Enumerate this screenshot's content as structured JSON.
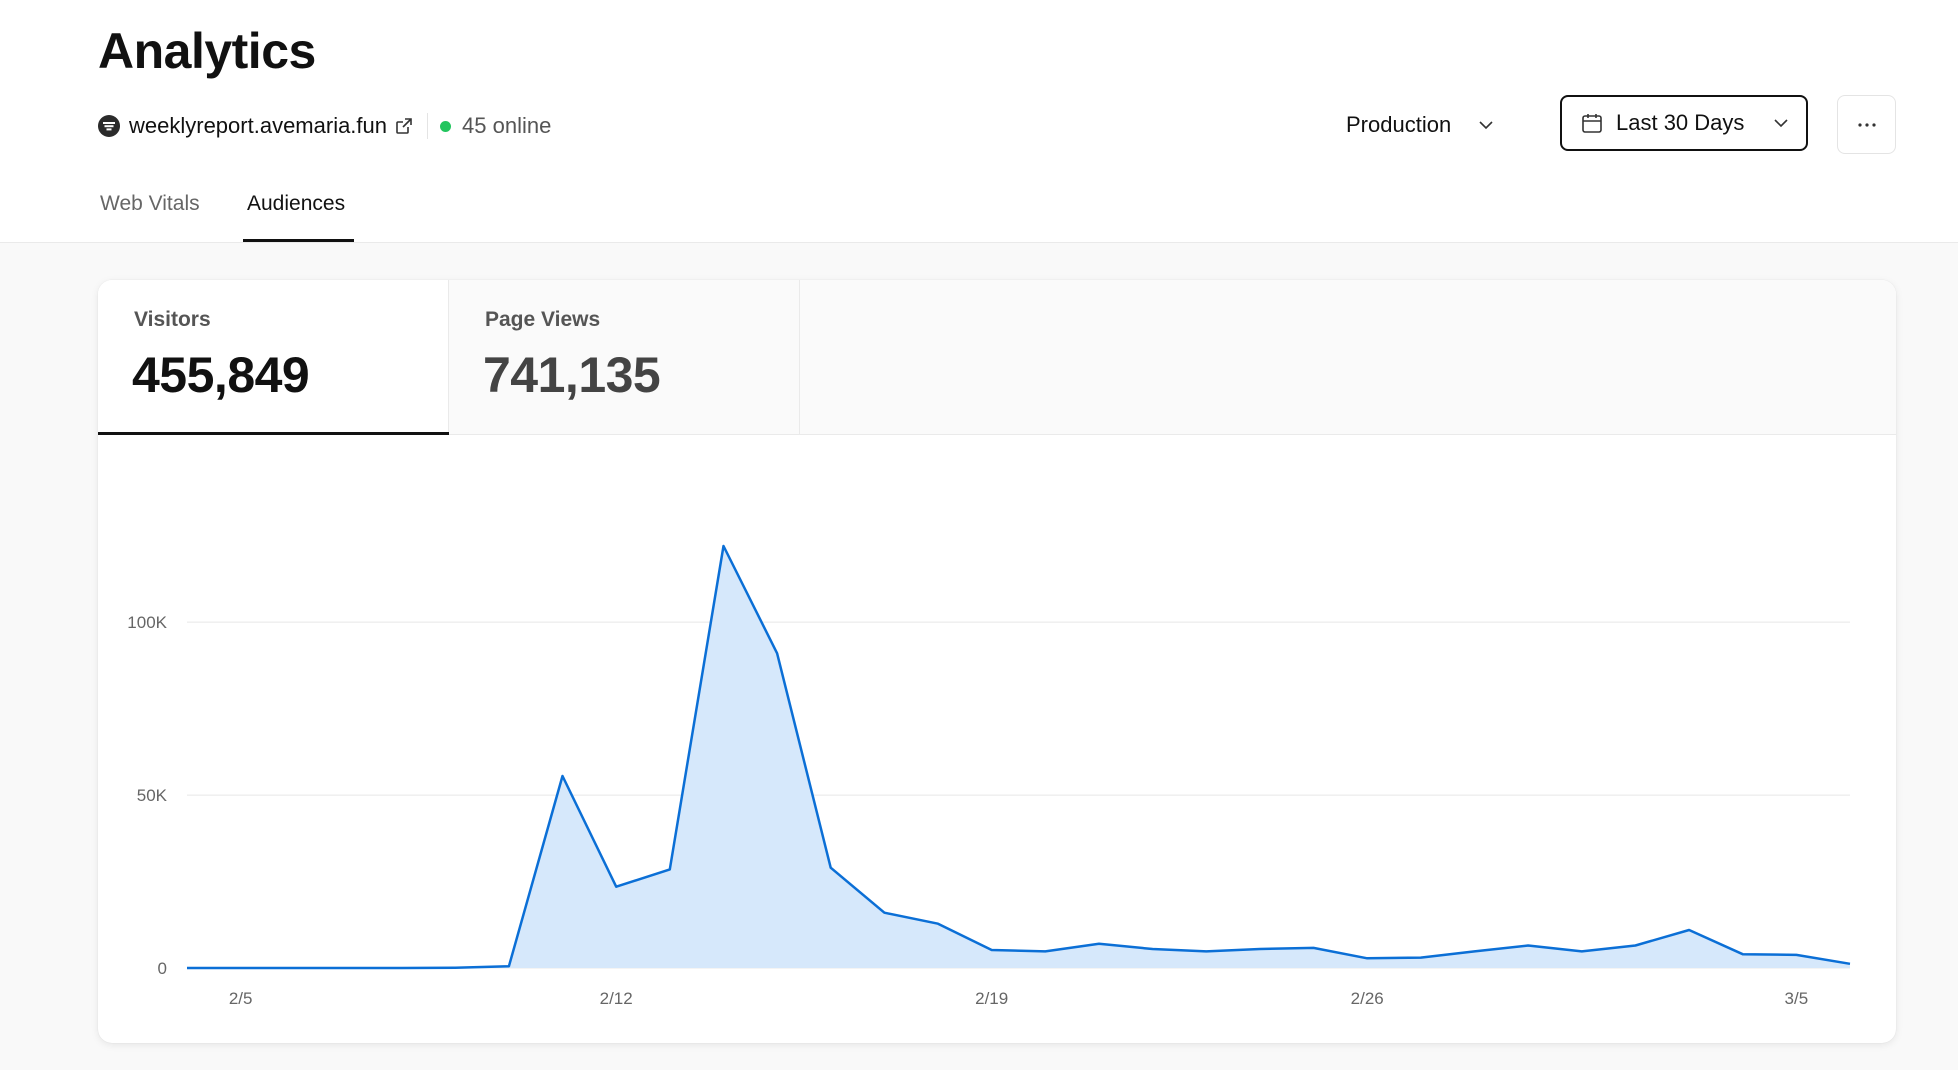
{
  "header": {
    "title": "Analytics",
    "site": {
      "name": "weeklyreport.avemaria.fun",
      "favicon": "site-favicon-icon",
      "external_icon": "external-link-icon"
    },
    "online": {
      "text": "45 online",
      "status_color": "#22c55e"
    },
    "environment": {
      "selected": "Production"
    },
    "date_range": {
      "selected": "Last 30 Days",
      "icon": "calendar-icon"
    },
    "more_icon": "more-horizontal-icon"
  },
  "tabs": [
    {
      "label": "Web Vitals",
      "active": false
    },
    {
      "label": "Audiences",
      "active": true
    }
  ],
  "metrics": [
    {
      "label": "Visitors",
      "value": "455,849",
      "active": true
    },
    {
      "label": "Page Views",
      "value": "741,135",
      "active": false
    }
  ],
  "chart_data": {
    "type": "area",
    "x_tick_labels": [
      "2/5",
      "2/12",
      "2/19",
      "2/26",
      "3/5"
    ],
    "x": [
      "2/4",
      "2/5",
      "2/6",
      "2/7",
      "2/8",
      "2/9",
      "2/10",
      "2/11",
      "2/12",
      "2/13",
      "2/14",
      "2/15",
      "2/16",
      "2/17",
      "2/18",
      "2/19",
      "2/20",
      "2/21",
      "2/22",
      "2/23",
      "2/24",
      "2/25",
      "2/26",
      "2/27",
      "2/28",
      "2/29",
      "3/1",
      "3/2",
      "3/3",
      "3/4",
      "3/5",
      "3/6"
    ],
    "series": [
      {
        "values": [
          0,
          0,
          0,
          0,
          0,
          100,
          500,
          55500,
          23500,
          28500,
          122000,
          91000,
          29000,
          16000,
          12800,
          5200,
          4800,
          7000,
          5500,
          4800,
          5500,
          5800,
          2800,
          3000,
          4800,
          6500,
          4800,
          6500,
          11000,
          4000,
          3800,
          1200
        ]
      }
    ],
    "y_tick_labels": [
      "0",
      "50K",
      "100K"
    ],
    "y_ticks": [
      0,
      50000,
      100000
    ],
    "ylim": [
      0,
      133000
    ],
    "grid": true,
    "colors": {
      "line": "#0b6fd6",
      "fill": "#d6e8fb",
      "grid": "#e8e8e8"
    }
  }
}
